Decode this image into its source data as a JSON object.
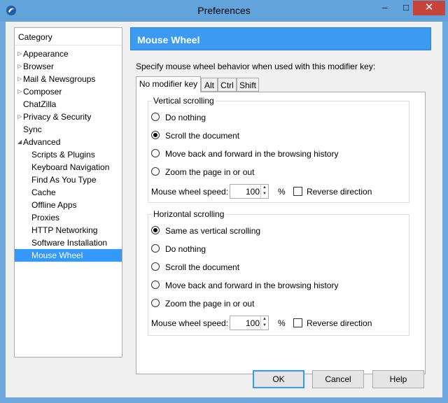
{
  "window": {
    "title": "Preferences",
    "minimize": "–",
    "maximize": "□",
    "close": "✕"
  },
  "category": {
    "header": "Category",
    "items": [
      {
        "label": "Appearance",
        "level": 0,
        "expandable": true
      },
      {
        "label": "Browser",
        "level": 0,
        "expandable": true
      },
      {
        "label": "Mail & Newsgroups",
        "level": 0,
        "expandable": true
      },
      {
        "label": "Composer",
        "level": 0,
        "expandable": true
      },
      {
        "label": "ChatZilla",
        "level": 0,
        "expandable": false
      },
      {
        "label": "Privacy & Security",
        "level": 0,
        "expandable": true
      },
      {
        "label": "Sync",
        "level": 0,
        "expandable": false
      },
      {
        "label": "Advanced",
        "level": 0,
        "expandable": true,
        "expanded": true
      },
      {
        "label": "Scripts & Plugins",
        "level": 1
      },
      {
        "label": "Keyboard Navigation",
        "level": 1
      },
      {
        "label": "Find As You Type",
        "level": 1
      },
      {
        "label": "Cache",
        "level": 1
      },
      {
        "label": "Offline Apps",
        "level": 1
      },
      {
        "label": "Proxies",
        "level": 1
      },
      {
        "label": "HTTP Networking",
        "level": 1
      },
      {
        "label": "Software Installation",
        "level": 1
      },
      {
        "label": "Mouse Wheel",
        "level": 1,
        "selected": true
      }
    ]
  },
  "main": {
    "banner": "Mouse Wheel",
    "instruction": "Specify mouse wheel behavior when used with this modifier key:",
    "tabs": [
      "No modifier key",
      "Alt",
      "Ctrl",
      "Shift"
    ],
    "active_tab": 0,
    "vertical": {
      "legend": "Vertical scrolling",
      "options": [
        "Do nothing",
        "Scroll the document",
        "Move back and forward in the browsing history",
        "Zoom the page in or out"
      ],
      "selected": 1,
      "speed_label": "Mouse wheel speed:",
      "speed": "100",
      "unit": "%",
      "reverse_label": "Reverse direction",
      "reverse_checked": false
    },
    "horizontal": {
      "legend": "Horizontal scrolling",
      "options": [
        "Same as vertical scrolling",
        "Do nothing",
        "Scroll the document",
        "Move back and forward in the browsing history",
        "Zoom the page in or out"
      ],
      "selected": 0,
      "speed_label": "Mouse wheel speed:",
      "speed": "100",
      "unit": "%",
      "reverse_label": "Reverse direction",
      "reverse_checked": false
    }
  },
  "buttons": {
    "ok": "OK",
    "cancel": "Cancel",
    "help": "Help"
  },
  "colors": {
    "accent": "#3a9bf0",
    "selection": "#3399ff",
    "close": "#c7443a"
  }
}
